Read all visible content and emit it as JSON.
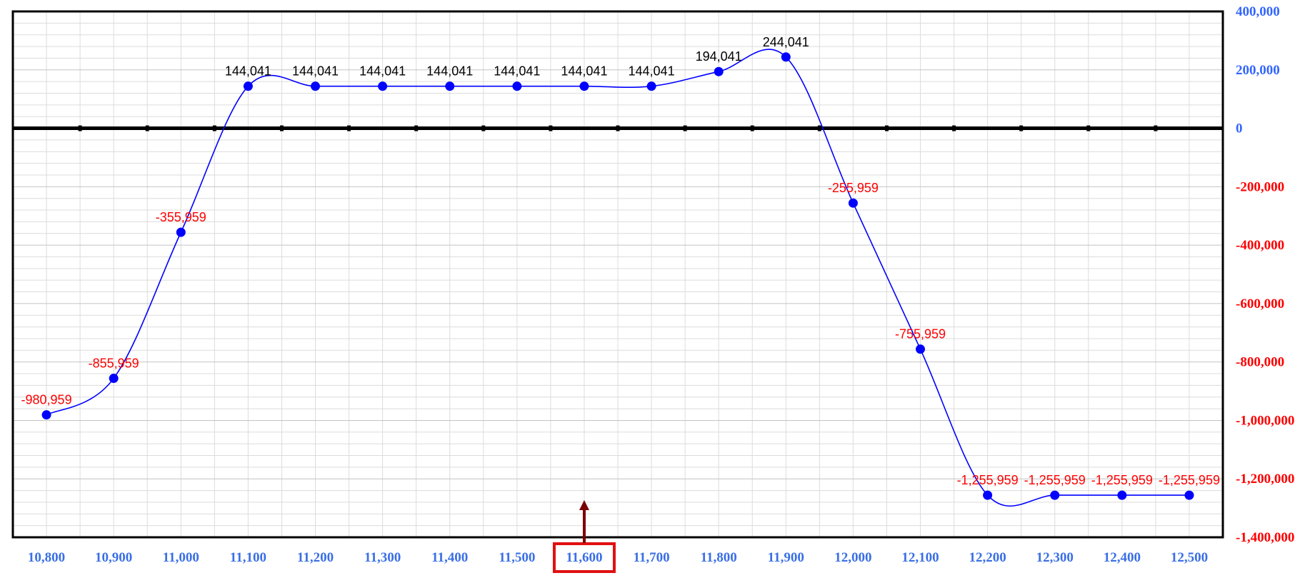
{
  "chart_data": {
    "type": "line",
    "title": "",
    "xlabel": "",
    "ylabel": "",
    "x": [
      10800,
      10900,
      11000,
      11100,
      11200,
      11300,
      11400,
      11500,
      11600,
      11700,
      11800,
      11900,
      12000,
      12100,
      12200,
      12300,
      12400,
      12500
    ],
    "x_tick_labels": [
      "10,800",
      "10,900",
      "11,000",
      "11,100",
      "11,200",
      "11,300",
      "11,400",
      "11,500",
      "11,600",
      "11,700",
      "11,800",
      "11,900",
      "12,000",
      "12,100",
      "12,200",
      "12,300",
      "12,400",
      "12,500"
    ],
    "series": [
      {
        "values": [
          -980959,
          -855959,
          -355959,
          144041,
          144041,
          144041,
          144041,
          144041,
          144041,
          144041,
          194041,
          244041,
          -255959,
          -755959,
          -1255959,
          -1255959,
          -1255959,
          -1255959
        ],
        "labels": [
          "-980,959",
          "-855,959",
          "-355,959",
          "144,041",
          "144,041",
          "144,041",
          "144,041",
          "144,041",
          "144,041",
          "144,041",
          "194,041",
          "244,041",
          "-255,959",
          "-755,959",
          "-1,255,959",
          "-1,255,959",
          "-1,255,959",
          "-1,255,959"
        ],
        "color": "#0000ff",
        "smooth": true
      }
    ],
    "ylim": [
      -1400000,
      400000
    ],
    "xlim": [
      10750,
      12550
    ],
    "y_ticks": [
      400000,
      200000,
      0,
      -200000,
      -400000,
      -600000,
      -800000,
      -1000000,
      -1200000,
      -1400000
    ],
    "y_tick_labels": [
      "400,000",
      "200,000",
      "0",
      "-200,000",
      "-400,000",
      "-600,000",
      "-800,000",
      "-1,000,000",
      "-1,200,000",
      "-1,400,000"
    ],
    "y_axis_position": "right",
    "grid": true,
    "legend": "none",
    "highlighted_x": 11600,
    "highlighted_x_label": "11,600",
    "colors": {
      "line": "#0000ff",
      "marker": "#0000ff",
      "positive_label": "#000000",
      "negative_label": "#ff0000",
      "positive_axis_label": "#3366ff",
      "negative_axis_label": "#ff0000",
      "x_axis_label": "#3a6fe6",
      "highlight_box": "#e01010",
      "highlight_arrow": "#7a0000"
    }
  }
}
